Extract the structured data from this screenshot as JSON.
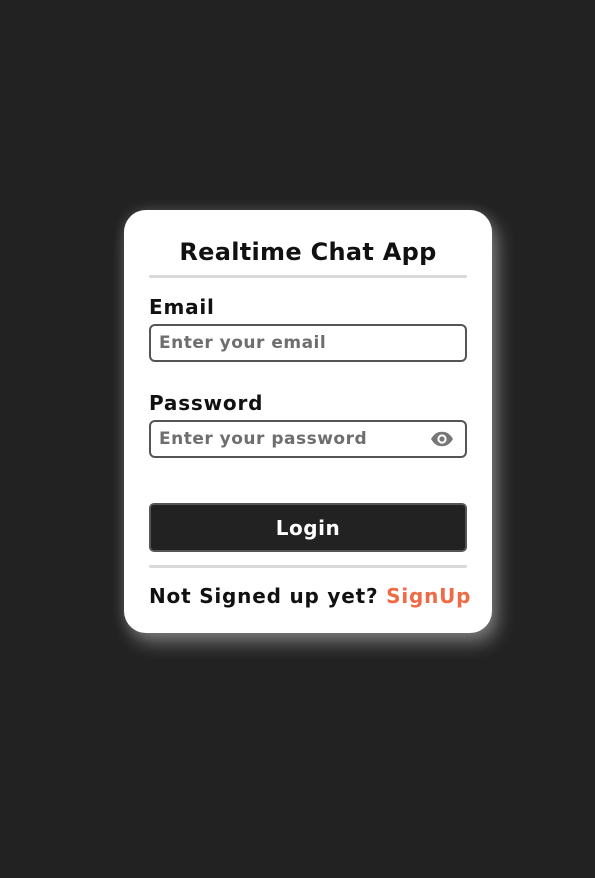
{
  "app": {
    "title": "Realtime Chat App"
  },
  "form": {
    "email": {
      "label": "Email",
      "placeholder": "Enter your email",
      "value": ""
    },
    "password": {
      "label": "Password",
      "placeholder": "Enter your password",
      "value": "",
      "toggle_icon": "eye-icon"
    },
    "login_label": "Login"
  },
  "signup": {
    "prompt": "Not Signed up yet?",
    "link_label": "SignUp"
  },
  "colors": {
    "background": "#222222",
    "card": "#ffffff",
    "accent": "#ee6b45",
    "button": "#222222"
  }
}
